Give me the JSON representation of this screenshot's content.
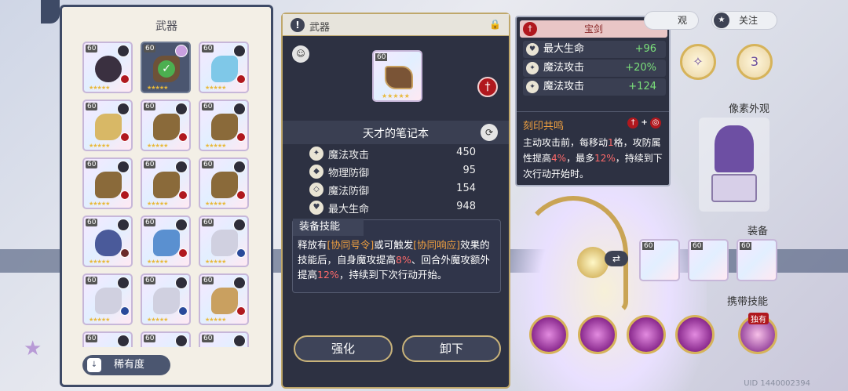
{
  "list_panel": {
    "title": "武器",
    "rarity_label": "稀有度",
    "level": "60",
    "star_glyph": "★★★★★",
    "check_glyph": "✓"
  },
  "detail": {
    "header": "武器",
    "weapon_level": "60",
    "weapon_name": "天才的笔记本",
    "stats": [
      {
        "name": "魔法攻击",
        "value": "450",
        "icon": "magic-attack-icon"
      },
      {
        "name": "物理防御",
        "value": "95",
        "icon": "physical-defense-icon"
      },
      {
        "name": "魔法防御",
        "value": "154",
        "icon": "magic-defense-icon"
      },
      {
        "name": "最大生命",
        "value": "948",
        "icon": "heart-icon"
      }
    ],
    "skill_title": "装备技能",
    "skill_parts": {
      "p1": "释放有",
      "t1": "[协同号令]",
      "p2": "或可触发",
      "t2": "[协同响应]",
      "p3": "效果的技能后，自身魔攻提高",
      "v1": "8%",
      "p4": "、回合外魔攻额外提高",
      "v2": "12%",
      "p5": "，持续到下次行动开始。"
    },
    "buttons": {
      "enhance": "强化",
      "unequip": "卸下"
    }
  },
  "bonus": {
    "title": "宝剑",
    "rows": [
      {
        "name": "最大生命",
        "value": "+96",
        "icon": "heart-icon"
      },
      {
        "name": "魔法攻击",
        "value": "+20%",
        "icon": "magic-attack-icon"
      },
      {
        "name": "魔法攻击",
        "value": "+124",
        "icon": "magic-attack-icon"
      }
    ],
    "resonance_title": "刻印共鸣",
    "resonance_plus": "+",
    "resonance_parts": {
      "p1": "主动攻击前，每移动",
      "v1": "1",
      "p2": "格，攻防属性提高",
      "v2": "4%",
      "p3": "，最多",
      "v3": "12%",
      "p4": "，持续到下次行动开始时。"
    }
  },
  "right": {
    "tab_view": "观",
    "tab_follow": "关注",
    "emblem_number": "3",
    "pixel_look_label": "像素外观",
    "equip_label": "装备",
    "equip_level": "60",
    "carry_skill_label": "携带技能",
    "exclusive_label": "独有",
    "uid": "UID 1440002394"
  },
  "colors": {
    "panel_dark": "#2d3142",
    "accent_gold": "#bfa76a",
    "positive": "#7be07b",
    "highlight_orange": "#f0a040",
    "highlight_red": "#ff6a6a",
    "sword_red": "#b0181e"
  }
}
